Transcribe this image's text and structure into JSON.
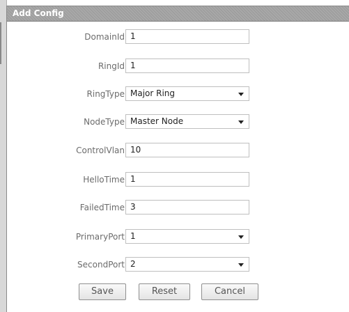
{
  "dialog": {
    "title": "Add Config"
  },
  "form": {
    "fields": [
      {
        "label": "DomainId",
        "value": "1",
        "type": "input"
      },
      {
        "label": "RingId",
        "value": "1",
        "type": "input"
      },
      {
        "label": "RingType",
        "value": "Major Ring",
        "type": "select"
      },
      {
        "label": "NodeType",
        "value": "Master Node",
        "type": "select"
      },
      {
        "label": "ControlVlan",
        "value": "10",
        "type": "input"
      },
      {
        "label": "HelloTime",
        "value": "1",
        "type": "input"
      },
      {
        "label": "FailedTime",
        "value": "3",
        "type": "input"
      },
      {
        "label": "PrimaryPort",
        "value": "1",
        "type": "select"
      },
      {
        "label": "SecondPort",
        "value": "2",
        "type": "select"
      }
    ]
  },
  "buttons": {
    "save": "Save",
    "reset": "Reset",
    "cancel": "Cancel"
  },
  "icons": {
    "select_caret": "chevron-down-icon"
  }
}
